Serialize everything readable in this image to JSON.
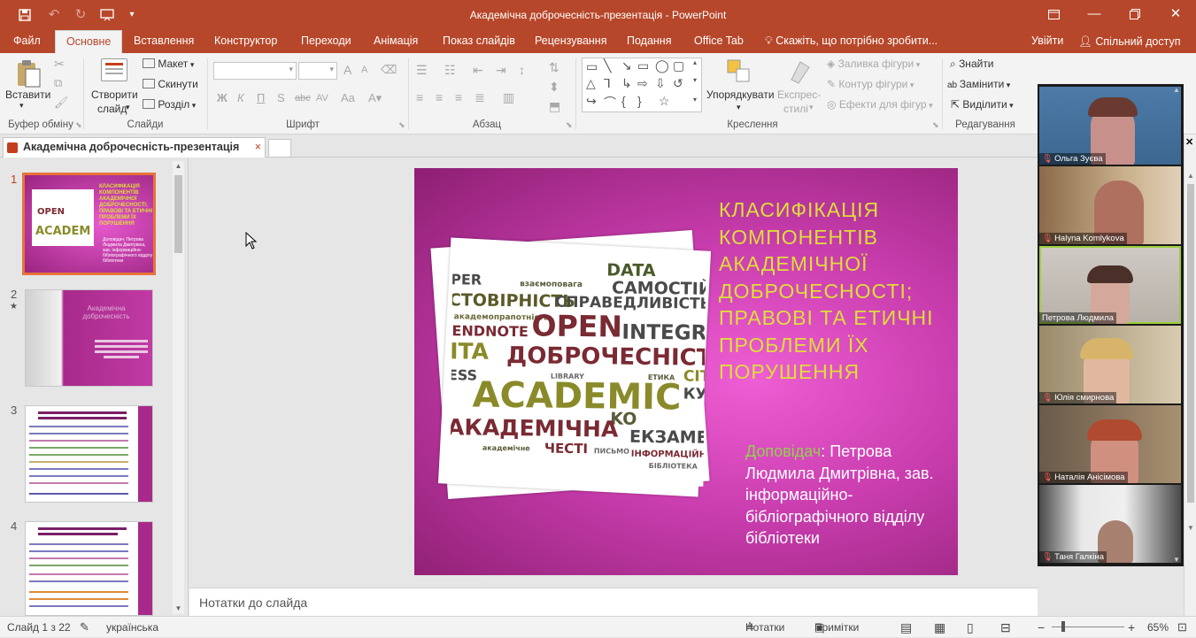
{
  "window": {
    "title": "Академічна доброчесність-презентація - PowerPoint",
    "controls": [
      "restore-icon",
      "minimize-icon",
      "maximize-icon",
      "close-icon"
    ]
  },
  "quick_access": [
    "save-icon",
    "undo-icon",
    "redo-icon",
    "slideshow-from-start-icon",
    "customize-icon"
  ],
  "ribbon_tabs": [
    "Файл",
    "Основне",
    "Вставлення",
    "Конструктор",
    "Переходи",
    "Анімація",
    "Показ слайдів",
    "Рецензування",
    "Подання",
    "Office Tab"
  ],
  "active_tab": "Основне",
  "tell_me": "Скажіть, що потрібно зробити...",
  "account": {
    "login": "Увійти",
    "share": "Спільний доступ"
  },
  "ribbon": {
    "clipboard": {
      "paste": "Вставити",
      "group": "Буфер обміну"
    },
    "slides": {
      "new_slide_1": "Створити",
      "new_slide_2": "слайд",
      "layout": "Макет",
      "reset": "Скинути",
      "section": "Розділ",
      "group": "Слайди"
    },
    "font": {
      "bold": "Ж",
      "italic": "К",
      "underline": "П",
      "shadow": "S",
      "strike": "abc",
      "case": "Aa",
      "grow": "A",
      "shrink": "A",
      "group": "Шрифт"
    },
    "paragraph": {
      "group": "Абзац"
    },
    "drawing": {
      "arrange_1": "Упорядкувати",
      "quick_styles_1": "Експрес-",
      "quick_styles_2": "стилі",
      "fill": "Заливка фігури",
      "outline": "Контур фігури",
      "effects": "Ефекти для фігур",
      "group": "Креслення"
    },
    "editing": {
      "find": "Знайти",
      "replace": "Замінити",
      "select": "Виділити",
      "group": "Редагування"
    }
  },
  "document_tab": {
    "label": "Академічна доброчесність-презентація",
    "close": "×"
  },
  "slide_thumbnails": [
    {
      "number": "1",
      "selected": true,
      "title": "КЛАСИФІКАЦІЯ КОМПОНЕНТІВ АКАДЕМІЧНОЇ ДОБРОЧЕСНОСТІ; ПРАВОВІ ТА ЕТИЧНІ ПРОБЛЕМИ ЇХ ПОРУШЕННЯ",
      "presenter": "Доповідач: Петрова Людмила Дмитрівна, зав. інформаційно-бібліографічного відділу бібліотеки"
    },
    {
      "number": "2",
      "star": "★",
      "title": "Академічна доброчесність"
    },
    {
      "number": "3"
    },
    {
      "number": "4"
    }
  ],
  "slide": {
    "title": "КЛАСИФІКАЦІЯ КОМПОНЕНТІВ АКАДЕМІЧНОЇ ДОБРОЧЕСНОСТІ; ПРАВОВІ ТА ЕТИЧНІ ПРОБЛЕМИ ЇХ ПОРУШЕННЯ",
    "presenter_label": "Доповідач",
    "presenter_text": ": Петрова Людмила Дмитрівна, зав. інформаційно-бібліографічного відділу бібліотеки",
    "word_cloud": [
      "DATA",
      "PER",
      "взаємоповага",
      "САМОСТІЙН",
      "СТОВІРНІСТЬ",
      "СПРАВЕДЛИВІСТЬ",
      "академопрапотність",
      "ENDNOTE",
      "OPEN",
      "INTEGR",
      "ITA",
      "ДОБРОЧЕСНІСТЬ",
      "ESS",
      "LIBRARY",
      "ЕТИКА",
      "CIT",
      "ACADEMIC",
      "КУЛЬТУРА",
      "KO",
      "АКАДЕМІЧНА",
      "ЕКЗАМЕ",
      "академічне",
      "ЧЕСТІ",
      "ПИСЬМО",
      "ІНФОРМАЦІЙНА",
      "БІБЛІОТЕКА"
    ]
  },
  "notes_placeholder": "Нотатки до слайда",
  "status": {
    "slide_counter": "Слайд 1 з 22",
    "language": "українська",
    "notes": "Нотатки",
    "comments": "Примітки",
    "zoom": "65%",
    "zoom_level": 0.25
  },
  "video_participants": [
    {
      "name": "Ольга Зуєва",
      "muted": true,
      "active": false
    },
    {
      "name": "Halyna Komlykova",
      "muted": true,
      "active": false
    },
    {
      "name": "Петрова Людмила",
      "muted": false,
      "active": true
    },
    {
      "name": "Юлія смирнова",
      "muted": true,
      "active": false
    },
    {
      "name": "Наталія Анісімова",
      "muted": true,
      "active": false
    },
    {
      "name": "Таня Галкіна",
      "muted": true,
      "active": false
    }
  ],
  "colors": {
    "accent": "#b7472a",
    "slide_bg": "#c93dae",
    "title_yellow": "#dede3a",
    "presenter_green": "#92d050",
    "selection_orange": "#e8733a"
  }
}
